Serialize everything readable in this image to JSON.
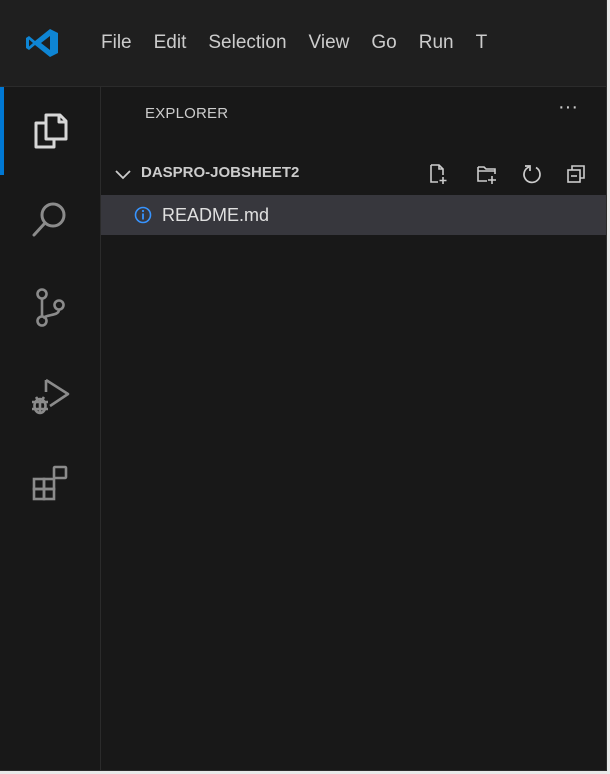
{
  "app": {
    "logo_icon": "vscode-logo-icon",
    "accent_color": "#0078d4",
    "menu": [
      "File",
      "Edit",
      "Selection",
      "View",
      "Go",
      "Run",
      "T"
    ]
  },
  "activity_bar": {
    "items": [
      {
        "icon": "explorer-icon",
        "active": true
      },
      {
        "icon": "search-icon",
        "active": false
      },
      {
        "icon": "source-control-icon",
        "active": false
      },
      {
        "icon": "run-debug-icon",
        "active": false
      },
      {
        "icon": "extensions-icon",
        "active": false
      }
    ]
  },
  "sidebar": {
    "title": "EXPLORER",
    "more_label": "···",
    "folder": {
      "name": "DASPRO-JOBSHEET2",
      "expanded": true,
      "toolbar_icons": [
        "new-file-icon",
        "new-folder-icon",
        "refresh-icon",
        "collapse-all-icon"
      ]
    },
    "files": [
      {
        "name": "README.md",
        "icon": "info-icon",
        "icon_color": "#3794ff",
        "selected": true
      }
    ]
  }
}
